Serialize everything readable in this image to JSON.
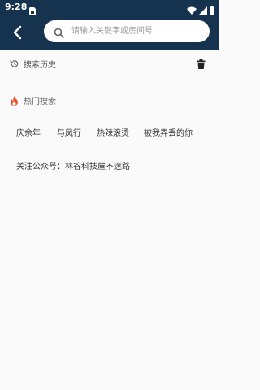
{
  "statusbar": {
    "time": "9:28"
  },
  "topbar": {
    "search_placeholder": "请输入关键字或房间号",
    "search_label": "搜索"
  },
  "history": {
    "title": "搜索历史"
  },
  "hot": {
    "title": "热门搜索",
    "items": [
      "庆余年",
      "与凤行",
      "热辣滚烫",
      "被我弄丢的你",
      "关注公众号：林谷科技屋",
      "不迷路"
    ]
  },
  "colors": {
    "header": "#15324f",
    "hot_icon": "#e8532b"
  }
}
